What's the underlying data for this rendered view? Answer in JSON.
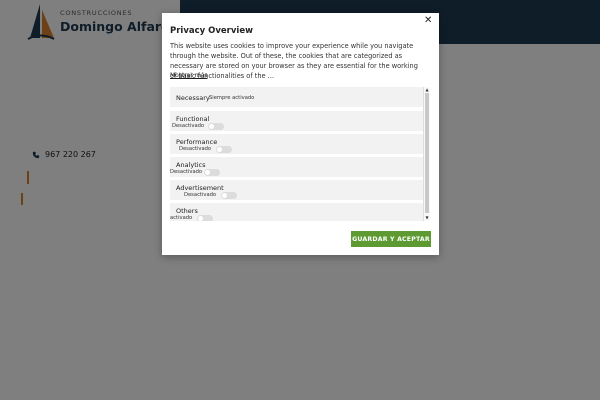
{
  "site": {
    "brand_small": "CONSTRUCCIONES",
    "brand_name": "Domingo Alfaro",
    "phone": "967 220 267",
    "colors": {
      "navy": "#1f3b52",
      "orange": "#d9822b"
    }
  },
  "modal": {
    "title": "Privacy Overview",
    "description": "This website uses cookies to improve your experience while you navigate through the website. Out of these, the cookies that are categorized as necessary are stored on your browser as they are essential for the working of basic functionalities of the ...",
    "show_more": "Mostrar más",
    "close_icon": "close-icon",
    "save_button": "GUARDAR Y ACEPTAR",
    "accent_color": "#5d9a32",
    "categories": [
      {
        "label": "Necessary",
        "status": "Siempre activado"
      },
      {
        "label": "Functional",
        "status": "Desactivado"
      },
      {
        "label": "Performance",
        "status": "Desactivado"
      },
      {
        "label": "Analytics",
        "status": "Desactivado"
      },
      {
        "label": "Advertisement",
        "status": "Desactivado"
      },
      {
        "label": "Others",
        "status": "activado"
      }
    ]
  }
}
